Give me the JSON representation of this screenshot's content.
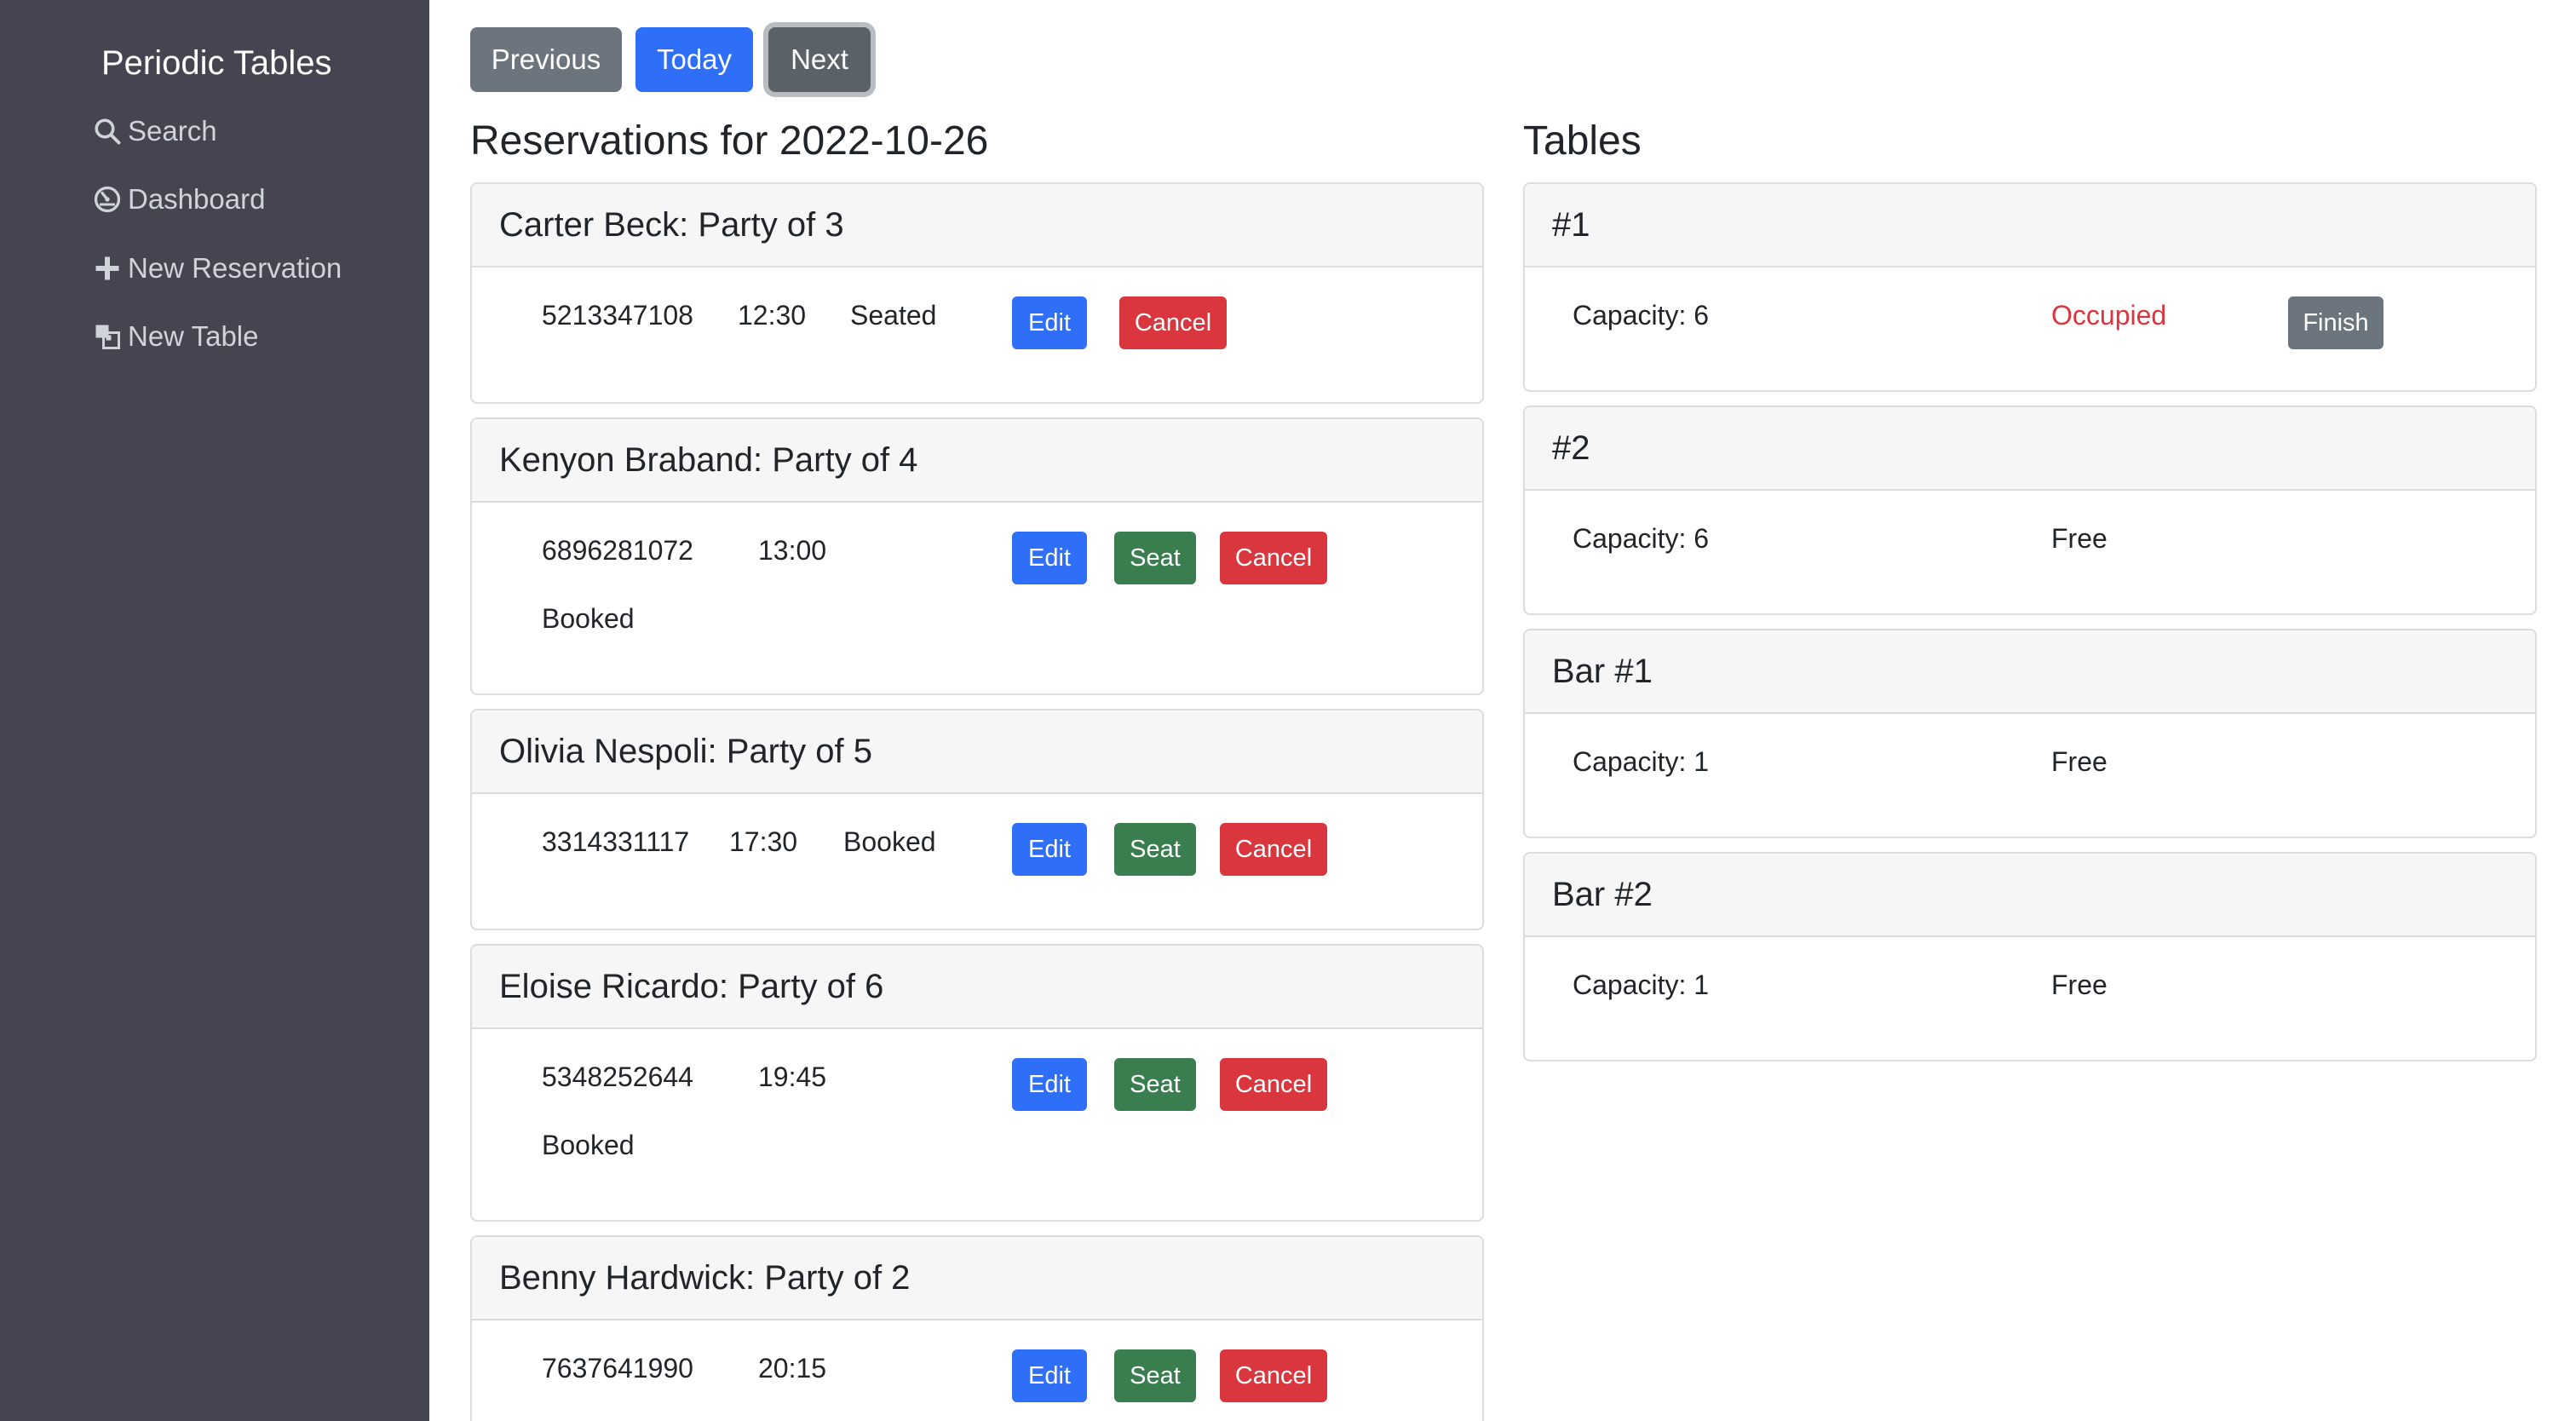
{
  "sidebar": {
    "brand": "Periodic Tables",
    "items": [
      {
        "label": "Search",
        "icon": "search-icon"
      },
      {
        "label": "Dashboard",
        "icon": "dashboard-icon"
      },
      {
        "label": "New Reservation",
        "icon": "plus-icon"
      },
      {
        "label": "New Table",
        "icon": "table-icon"
      }
    ]
  },
  "nav_buttons": {
    "previous": "Previous",
    "today": "Today",
    "next": "Next"
  },
  "reservations": {
    "title": "Reservations for 2022-10-26",
    "items": [
      {
        "header": "Carter Beck: Party of 3",
        "phone": "5213347108",
        "time": "12:30",
        "status": "Seated",
        "edit": "Edit",
        "cancel": "Cancel"
      },
      {
        "header": "Kenyon Braband: Party of 4",
        "phone": "6896281072",
        "time": "13:00",
        "status": "Booked",
        "edit": "Edit",
        "seat": "Seat",
        "cancel": "Cancel"
      },
      {
        "header": "Olivia Nespoli: Party of 5",
        "phone": "3314331117",
        "time": "17:30",
        "status": "Booked",
        "edit": "Edit",
        "seat": "Seat",
        "cancel": "Cancel"
      },
      {
        "header": "Eloise Ricardo: Party of 6",
        "phone": "5348252644",
        "time": "19:45",
        "status": "Booked",
        "edit": "Edit",
        "seat": "Seat",
        "cancel": "Cancel"
      },
      {
        "header": "Benny Hardwick: Party of 2",
        "phone": "7637641990",
        "time": "20:15",
        "edit": "Edit",
        "seat": "Seat",
        "cancel": "Cancel"
      }
    ]
  },
  "tables": {
    "title": "Tables",
    "items": [
      {
        "name": "#1",
        "capacity": "Capacity: 6",
        "status": "Occupied",
        "finish": "Finish"
      },
      {
        "name": "#2",
        "capacity": "Capacity: 6",
        "status": "Free"
      },
      {
        "name": "Bar #1",
        "capacity": "Capacity: 1",
        "status": "Free"
      },
      {
        "name": "Bar #2",
        "capacity": "Capacity: 1",
        "status": "Free"
      }
    ]
  },
  "colors": {
    "sidebar_bg": "#454551",
    "primary": "#2f6ff7",
    "success": "#3a7d4f",
    "danger": "#d9363e",
    "secondary": "#6c757d"
  }
}
